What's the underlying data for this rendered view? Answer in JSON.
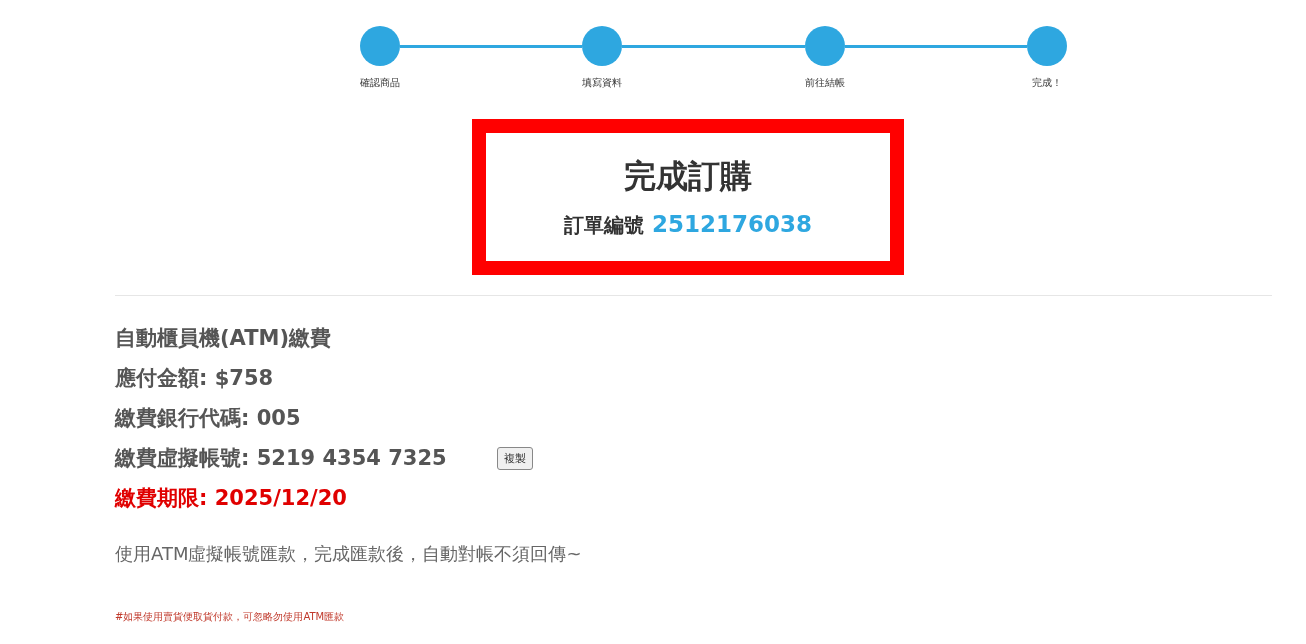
{
  "steps": [
    {
      "label": "確認商品",
      "done": true
    },
    {
      "label": "填寫資料",
      "done": true
    },
    {
      "label": "前往結帳",
      "done": true
    },
    {
      "label": "完成！",
      "done": true
    }
  ],
  "result": {
    "title": "完成訂購",
    "order_label": "訂單編號",
    "order_number": "2512176038"
  },
  "payment": {
    "method": "自動櫃員機(ATM)繳費",
    "rows": [
      {
        "label": "應付金額:",
        "value": "$758",
        "kind": "plain"
      },
      {
        "label": "繳費銀行代碼:",
        "value": "005",
        "kind": "plain"
      },
      {
        "label": "繳費虛擬帳號:",
        "value": "5219 4354 7325",
        "kind": "copy",
        "button": "複製"
      },
      {
        "label": "繳費期限:",
        "value": "2025/12/20",
        "kind": "deadline"
      }
    ],
    "note": "使用ATM虛擬帳號匯款，完成匯款後，自動對帳不須回傳~",
    "footnote": "#如果使用賣貨便取貨付款，可忽略勿使用ATM匯款"
  }
}
